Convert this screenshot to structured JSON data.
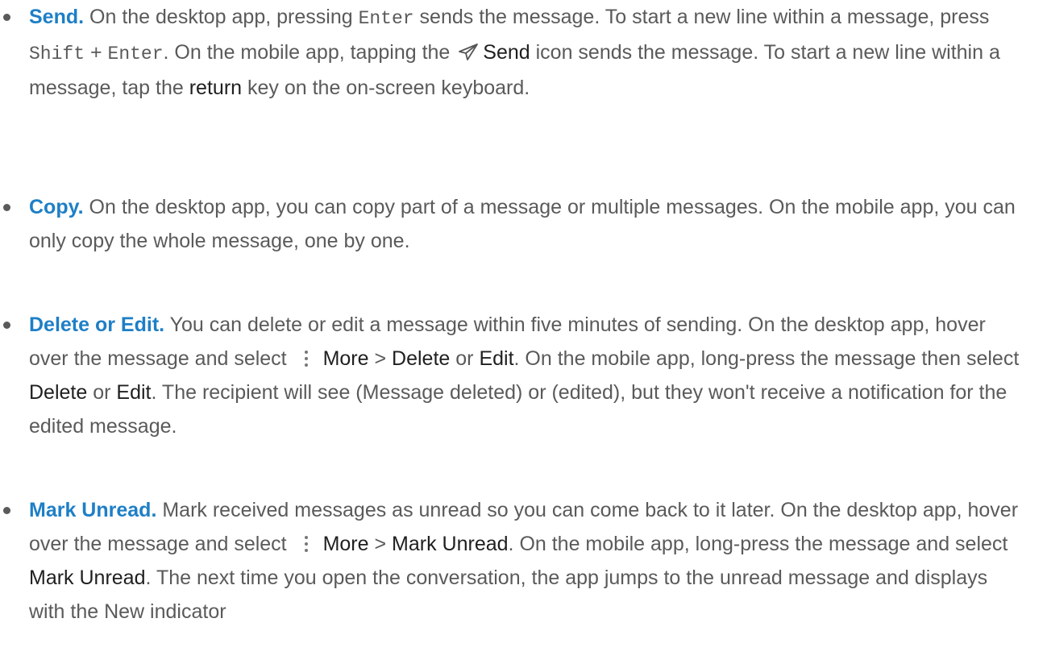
{
  "items": [
    {
      "term": "Send.",
      "p1": " On the desktop app, pressing ",
      "code1": "Enter",
      "p2": " sends the message. To start a new line within a message, press ",
      "code2": "Shift",
      "p3": " + ",
      "code3": "Enter",
      "p4": ". On the mobile app, tapping the ",
      "icon": "send-paper-plane-icon",
      "ui1": "Send",
      "p5": " icon sends the message. To start a new line within a message, tap the ",
      "ui2": "return",
      "p6": " key on the on-screen keyboard."
    },
    {
      "term": "Copy.",
      "p1": " On the desktop app, you can copy part of a message or multiple messages. On the mobile app, you can only copy the whole message, one by one."
    },
    {
      "term": "Delete or Edit.",
      "p1": " You can delete or edit a message within five minutes of sending. On the desktop app, hover over the message and select ",
      "icon": "more-vertical-icon",
      "ui1": "More",
      "p2": " > ",
      "ui2": "Delete",
      "p3": " or ",
      "ui3": "Edit",
      "p4": ". On the mobile app, long-press the message then select ",
      "ui4": "Delete",
      "p5": " or ",
      "ui5": "Edit",
      "p6": ". The recipient will see (Message deleted) or (edited), but they won't receive a notification for the edited message."
    },
    {
      "term": "Mark Unread.",
      "p1": "  Mark received messages as unread so you can come back to it later. On the desktop app, hover over the message and select ",
      "icon": "more-vertical-icon",
      "ui1": "More",
      "p2": " > ",
      "ui2": "Mark Unread",
      "p3": ". On the mobile app, long-press the message and select ",
      "ui3": "Mark Unread",
      "p4": ". The next time you open the conversation, the app jumps to the unread message and displays with the New indicator"
    }
  ],
  "colors": {
    "term": "#1e7fc6",
    "body_text": "#5a5a5a",
    "ui_text": "#1f1f1f"
  }
}
